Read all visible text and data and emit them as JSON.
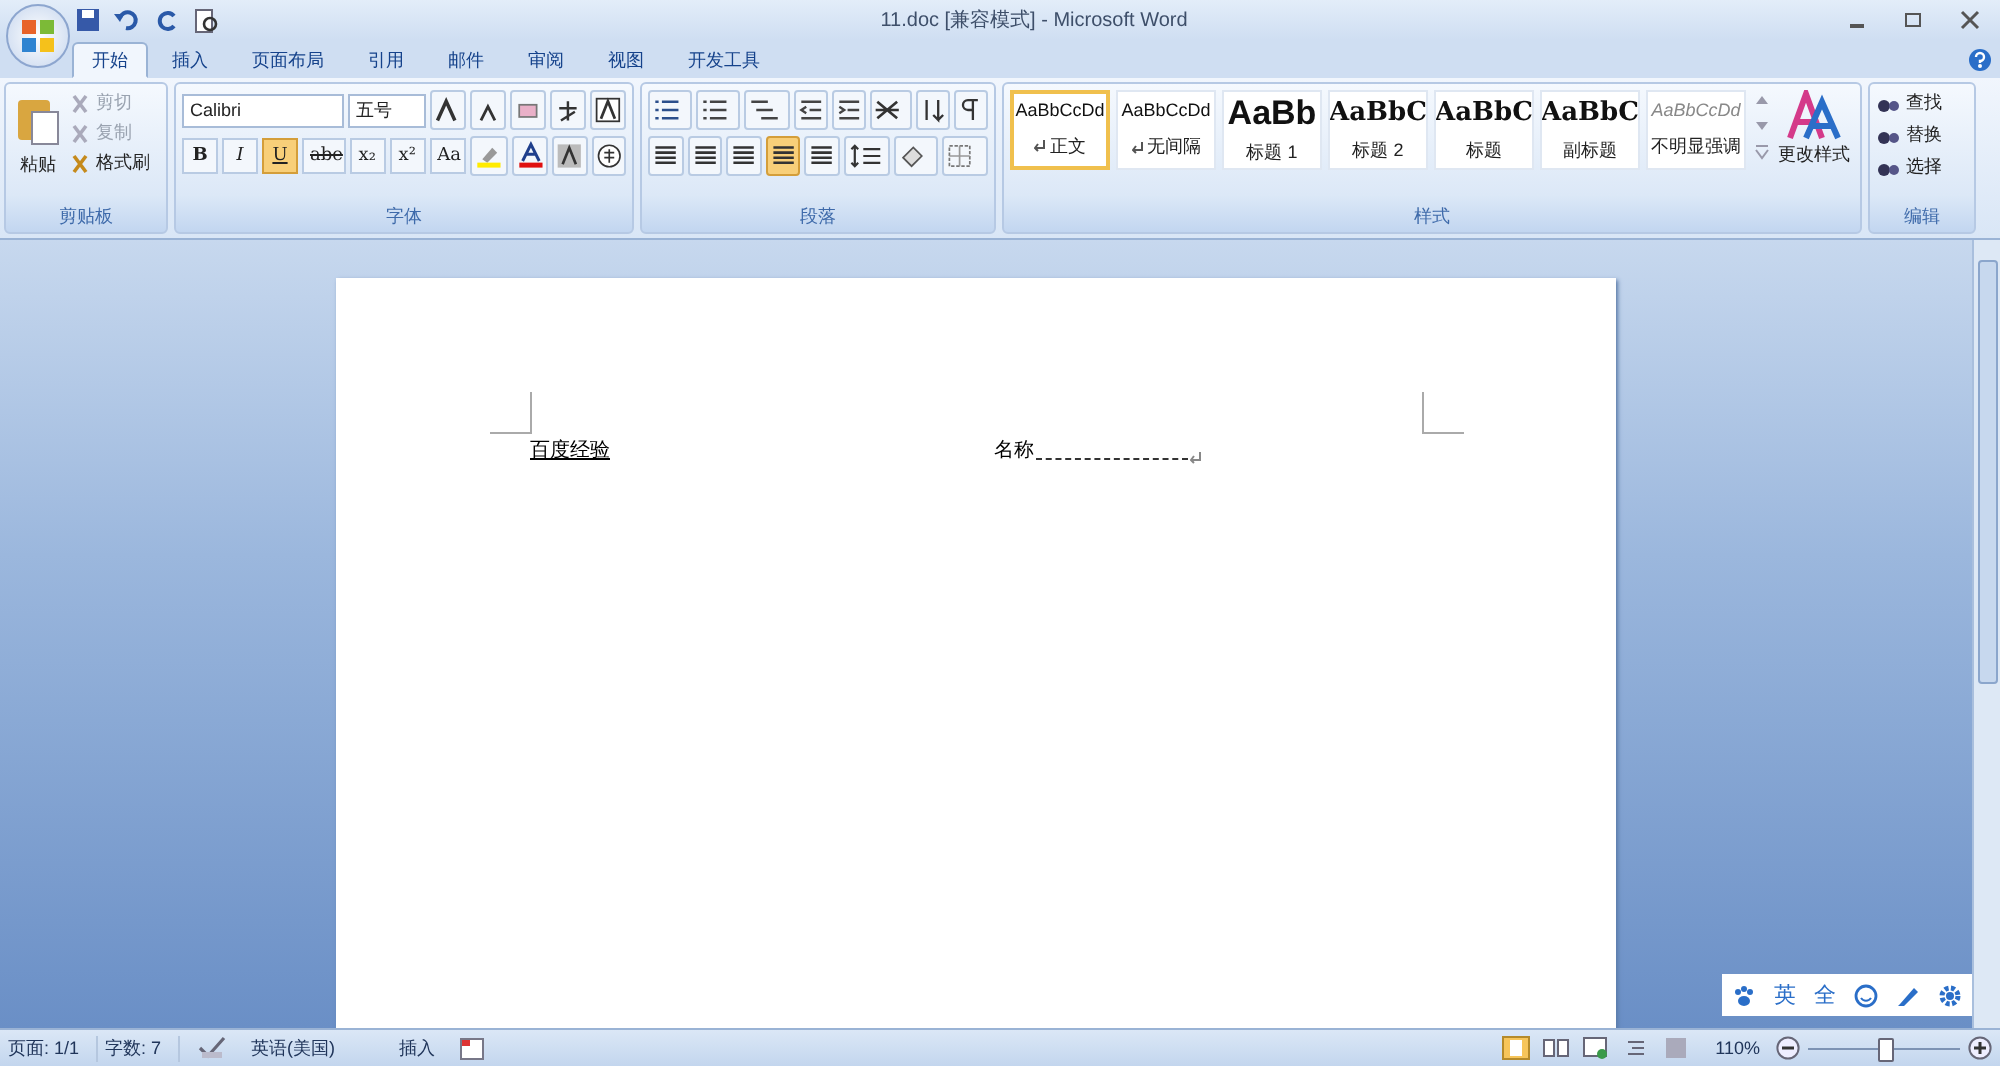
{
  "window": {
    "title": "11.doc [兼容模式] - Microsoft Word"
  },
  "tabs": [
    {
      "label": "开始",
      "selected": true
    },
    {
      "label": "插入",
      "selected": false
    },
    {
      "label": "页面布局",
      "selected": false
    },
    {
      "label": "引用",
      "selected": false
    },
    {
      "label": "邮件",
      "selected": false
    },
    {
      "label": "审阅",
      "selected": false
    },
    {
      "label": "视图",
      "selected": false
    },
    {
      "label": "开发工具",
      "selected": false
    }
  ],
  "clipboard": {
    "label": "剪贴板",
    "paste": "粘贴",
    "items": [
      {
        "label": "剪切",
        "disabled": true
      },
      {
        "label": "复制",
        "disabled": true
      },
      {
        "label": "格式刷",
        "disabled": false
      }
    ]
  },
  "font": {
    "label": "字体",
    "font_name": "Calibri",
    "font_size": "五号",
    "format_buttons": [
      {
        "label": "B",
        "kind": "bold",
        "selected": false
      },
      {
        "label": "I",
        "kind": "italic",
        "selected": false
      },
      {
        "label": "U",
        "kind": "underline",
        "selected": true
      },
      {
        "label": "abe",
        "kind": "strike",
        "selected": false
      },
      {
        "label": "x₂",
        "kind": "plain",
        "selected": false
      },
      {
        "label": "x²",
        "kind": "plain",
        "selected": false
      },
      {
        "label": "Aa",
        "kind": "plain",
        "selected": false
      }
    ]
  },
  "paragraph": {
    "label": "段落",
    "alignments": [
      {
        "selected": false
      },
      {
        "selected": false
      },
      {
        "selected": false
      },
      {
        "selected": true
      },
      {
        "selected": false
      }
    ]
  },
  "styles": {
    "label": "样式",
    "items": [
      {
        "sample": "AaBbCcDd",
        "name": "正文",
        "kind": "body",
        "paragraph_mark": true,
        "selected": true
      },
      {
        "sample": "AaBbCcDd",
        "name": "无间隔",
        "kind": "body",
        "paragraph_mark": true,
        "selected": false
      },
      {
        "sample": "AaBb",
        "name": "标题 1",
        "kind": "heading1",
        "paragraph_mark": false,
        "selected": false
      },
      {
        "sample": "AaBbC",
        "name": "标题 2",
        "kind": "heading",
        "paragraph_mark": false,
        "selected": false
      },
      {
        "sample": "AaBbC",
        "name": "标题",
        "kind": "heading",
        "paragraph_mark": false,
        "selected": false
      },
      {
        "sample": "AaBbC",
        "name": "副标题",
        "kind": "heading",
        "paragraph_mark": false,
        "selected": false
      },
      {
        "sample": "AaBbCcDd",
        "name": "不明显强调",
        "kind": "subtle",
        "paragraph_mark": false,
        "selected": false
      }
    ],
    "change_styles": "更改样式"
  },
  "editing": {
    "label": "编辑",
    "items": [
      "查找",
      "替换",
      "选择"
    ]
  },
  "document": {
    "left_text": "百度经验",
    "right_label": "名称"
  },
  "ime_bar": {
    "items": [
      {
        "kind": "paw"
      },
      {
        "kind": "text",
        "label": "英"
      },
      {
        "kind": "text",
        "label": "全"
      },
      {
        "kind": "smile"
      },
      {
        "kind": "pen"
      },
      {
        "kind": "gear"
      }
    ]
  },
  "status_bar": {
    "page": "页面: 1/1",
    "words": "字数: 7",
    "language": "英语(美国)",
    "mode": "插入",
    "zoom": "110%",
    "zoom_level": {
      "level": 0.5
    }
  }
}
